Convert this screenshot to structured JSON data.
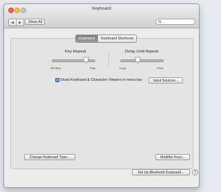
{
  "window": {
    "title": "Keyboard"
  },
  "toolbar": {
    "back_symbol": "◀",
    "forward_symbol": "▶",
    "show_all": "Show All",
    "search_value": ""
  },
  "tabs": [
    {
      "label": "Keyboard",
      "selected": true
    },
    {
      "label": "Keyboard Shortcuts",
      "selected": false
    }
  ],
  "key_repeat": {
    "heading": "Key Repeat",
    "min_label": "Off  Slow",
    "max_label": "Fast"
  },
  "delay_until_repeat": {
    "heading": "Delay Until Repeat",
    "min_label": "Long",
    "max_label": "Short"
  },
  "show_viewers": {
    "checked": true,
    "check_glyph": "✓",
    "label": "Show Keyboard & Character Viewers in menu bar"
  },
  "buttons": {
    "input_sources": "Input Sources...",
    "change_keyboard_type": "Change Keyboard Type...",
    "modifier_keys": "Modifier Keys...",
    "bluetooth": "Set Up Bluetooth Keyboard...",
    "help": "?"
  },
  "colors": {
    "accent": "#3b82e6",
    "close": "#fb5b57",
    "minimize": "#f7bd2e",
    "zoom": "#c3c3c3"
  }
}
